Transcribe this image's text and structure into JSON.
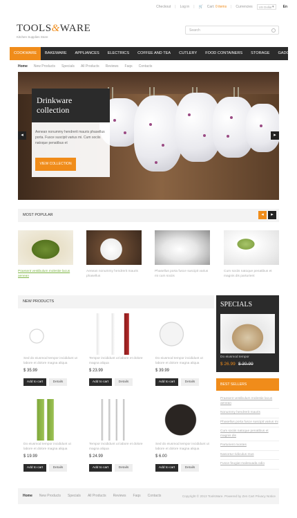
{
  "topbar": {
    "checkout": "Checkout",
    "login": "Log in",
    "cart_label": "Cart:",
    "cart_items": "0 items",
    "currencies": "Currencies",
    "currency_select": "US Dollar",
    "lang": "En"
  },
  "logo": {
    "part1": "TOOLS",
    "amp": "&",
    "part2": "WARE",
    "tagline": "Kitchen Supplies Store"
  },
  "search": {
    "placeholder": "Search"
  },
  "nav": {
    "items": [
      "Cookware",
      "Bakeware",
      "Appliances",
      "Electrics",
      "Coffee and Tea",
      "Cutlery",
      "Food Containers",
      "Storage",
      "Gadgets"
    ]
  },
  "subnav": {
    "items": [
      "Home",
      "New Products",
      "Specials",
      "All Products",
      "Reviews",
      "Faqs",
      "Contacts"
    ]
  },
  "slider": {
    "title": "Drinkware collection",
    "text": "Aenean nonummy hendrerit mauris phasellus porta. Fusce suscipit varius mi. Cum sociis natoque penatibus et",
    "button": "View Collection"
  },
  "popular": {
    "title": "Most Popular",
    "items": [
      "Praesent vestibulum molestie lacus aenean",
      "Aenean nonummy hendrerit mauris phasellus",
      "Phasellus porta fusce suscipit varius mi cum sociis",
      "Cum sociis natoque penatibus et magnis dis parturient"
    ]
  },
  "new_products": {
    "title": "New Products",
    "add_label": "Add to cart",
    "details_label": "Details",
    "items": [
      {
        "desc": "Sed do eiusmod tempor incididunt ut labore et dolore magna aliqua",
        "price": "$ 35.99"
      },
      {
        "desc": "Tempor incididunt ut labore et dolore magna aliqua",
        "price": "$ 23.99"
      },
      {
        "desc": "Do eiusmod tempor incididunt ut labore et dolore magna aliqua",
        "price": "$ 39.99"
      },
      {
        "desc": "Do eiusmod tempor incididunt ut labore et dolore magna aliqua",
        "price": "$ 19.99"
      },
      {
        "desc": "Tempor incididunt ut labore et dolore magna aliqua",
        "price": "$ 24.99"
      },
      {
        "desc": "Sed do eiusmod tempor incididunt ut labore et dolore magna aliqua",
        "price": "$ 6.00"
      }
    ]
  },
  "specials": {
    "title": "Specials",
    "name": "Do eiusmod tempor",
    "new_price": "$ 26.99",
    "old_price": "$ 30.99"
  },
  "best_sellers": {
    "title": "Best Sellers",
    "items": [
      "Praesent vestibulum molestie lacus aenean",
      "Nonummy hendrerit mauris",
      "Phasellus porta fusce suscipit varius mi",
      "Cum sociis natoque penatibus et magnis dis",
      "Parturient montes",
      "Nascetur ridiculus mus",
      "Fusce feugiat malesuada odio"
    ]
  },
  "footer": {
    "links": [
      "Home",
      "New Products",
      "Specials",
      "All Products",
      "Reviews",
      "Faqs",
      "Contacts"
    ],
    "copyright": "Copyright © 2013 ToolsWare. Powered by Zen Cart Privacy Notice"
  },
  "colors": {
    "accent": "#f08c1a",
    "dark": "#2b2b2b"
  }
}
